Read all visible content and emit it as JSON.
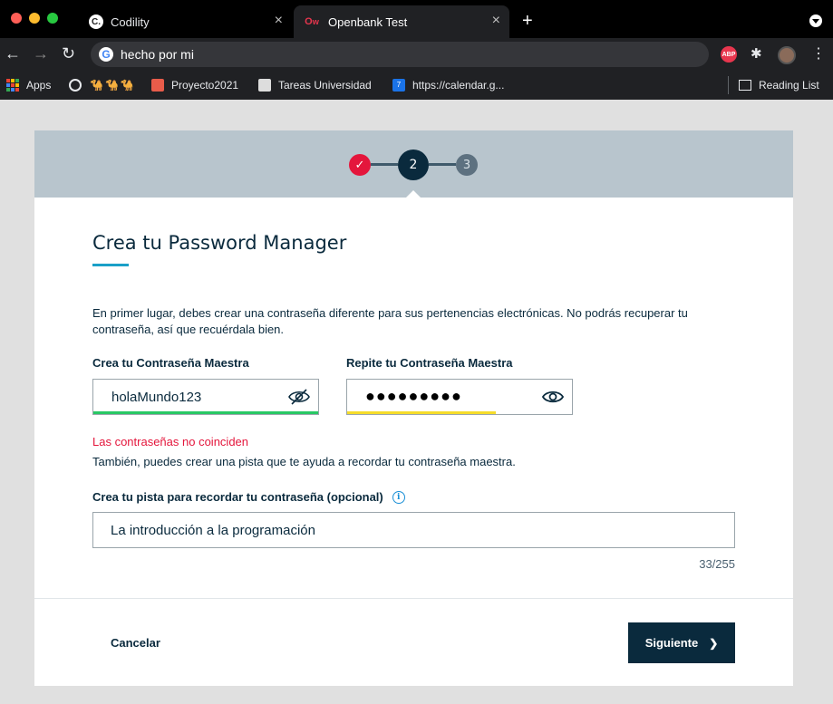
{
  "browser": {
    "tabs": [
      {
        "title": "Codility",
        "favicon": "codility-icon"
      },
      {
        "title": "Openbank Test",
        "favicon": "openbank-icon",
        "active": true
      }
    ],
    "address": "hecho por mi",
    "bookmarks": [
      {
        "label": "Apps",
        "icon": "apps-grid-icon"
      },
      {
        "label": "",
        "icon": "globe-icon"
      },
      {
        "label": "🐪🐪🐪",
        "icon": "camels"
      },
      {
        "label": "Proyecto2021",
        "icon": "trello-icon"
      },
      {
        "label": "Tareas Universidad",
        "icon": "document-icon"
      },
      {
        "label": "https://calendar.g...",
        "icon": "calendar-icon"
      }
    ],
    "reading_list": "Reading List",
    "extensions": [
      "adblock-icon",
      "puzzle-icon",
      "avatar"
    ]
  },
  "stepper": {
    "steps": [
      {
        "label": "✓",
        "state": "done"
      },
      {
        "label": "2",
        "state": "current"
      },
      {
        "label": "3",
        "state": "pending"
      }
    ],
    "colors": {
      "done": "#e4163c",
      "current": "#0a2a3d",
      "pending": "#5d7180"
    }
  },
  "form": {
    "title": "Crea tu Password Manager",
    "intro": "En primer lugar, debes crear una contraseña diferente para sus pertenencias electrónicas. No podrás recuperar tu contraseña, así que recuérdala bien.",
    "password": {
      "label": "Crea tu Contraseña Maestra",
      "value": "holaMundo123",
      "strength_fraction": 1.0,
      "strength_color": "#28c864"
    },
    "repeat": {
      "label": "Repite tu Contraseña Maestra",
      "value": "●●●●●●●●●",
      "strength_fraction": 0.66,
      "strength_color": "#f5dc2a"
    },
    "error": "Las contraseñas no coinciden",
    "hint_intro": "También, puedes crear una pista que te ayuda a recordar tu contraseña maestra.",
    "hint": {
      "label": "Crea tu pista para recordar tu contraseña (opcional)",
      "value": "La introducción a la programación",
      "counter": "33/255"
    },
    "actions": {
      "cancel": "Cancelar",
      "next": "Siguiente",
      "next_icon": "❯"
    }
  }
}
